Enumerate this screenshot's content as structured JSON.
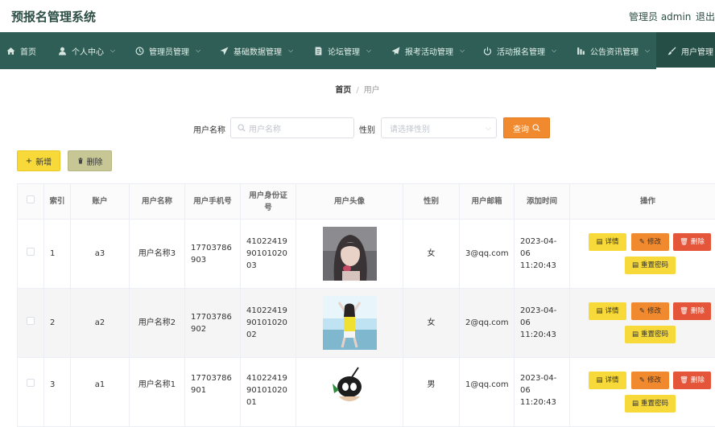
{
  "header": {
    "title": "预报名管理系统",
    "user": "管理员 admin",
    "logout": "退出登录"
  },
  "nav": [
    {
      "label": "首页",
      "icon": "home-icon"
    },
    {
      "label": "个人中心",
      "icon": "user-icon"
    },
    {
      "label": "管理员管理",
      "icon": "clock-icon"
    },
    {
      "label": "基础数据管理",
      "icon": "send-icon"
    },
    {
      "label": "论坛管理",
      "icon": "doc-icon"
    },
    {
      "label": "报考活动管理",
      "icon": "paper-plane-icon"
    },
    {
      "label": "活动报名管理",
      "icon": "power-icon"
    },
    {
      "label": "公告资讯管理",
      "icon": "chart-icon"
    },
    {
      "label": "用户管理",
      "icon": "brush-icon"
    }
  ],
  "breadcrumb": {
    "home": "首页",
    "sep": "/",
    "current": "用户"
  },
  "search": {
    "name_label": "用户名称",
    "name_placeholder": "用户名称",
    "gender_label": "性别",
    "gender_placeholder": "请选择性别",
    "query_button": "查询"
  },
  "actions": {
    "add": "新增",
    "delete": "删除"
  },
  "table": {
    "headers": [
      "索引",
      "账户",
      "用户名称",
      "用户手机号",
      "用户身份证号",
      "用户头像",
      "性别",
      "用户邮箱",
      "添加时间",
      "操作"
    ],
    "rows": [
      {
        "index": "1",
        "account": "a3",
        "name": "用户名称3",
        "phone": "17703786903",
        "idcard": "410224199010102003",
        "gender": "女",
        "email": "3@qq.com",
        "time": "2023-04-06 11:20:43"
      },
      {
        "index": "2",
        "account": "a2",
        "name": "用户名称2",
        "phone": "17703786902",
        "idcard": "410224199010102002",
        "gender": "女",
        "email": "2@qq.com",
        "time": "2023-04-06 11:20:43"
      },
      {
        "index": "3",
        "account": "a1",
        "name": "用户名称1",
        "phone": "17703786901",
        "idcard": "410224199010102001",
        "gender": "男",
        "email": "1@qq.com",
        "time": "2023-04-06 11:20:43"
      }
    ],
    "ops": {
      "detail": "详情",
      "edit": "修改",
      "remove": "删除",
      "reset": "重置密码"
    }
  },
  "colors": {
    "nav_bg": "#2e5e55",
    "accent_orange": "#f18a2e",
    "accent_yellow": "#f7d93a",
    "danger": "#e4553a",
    "olive": "#c7c796"
  }
}
